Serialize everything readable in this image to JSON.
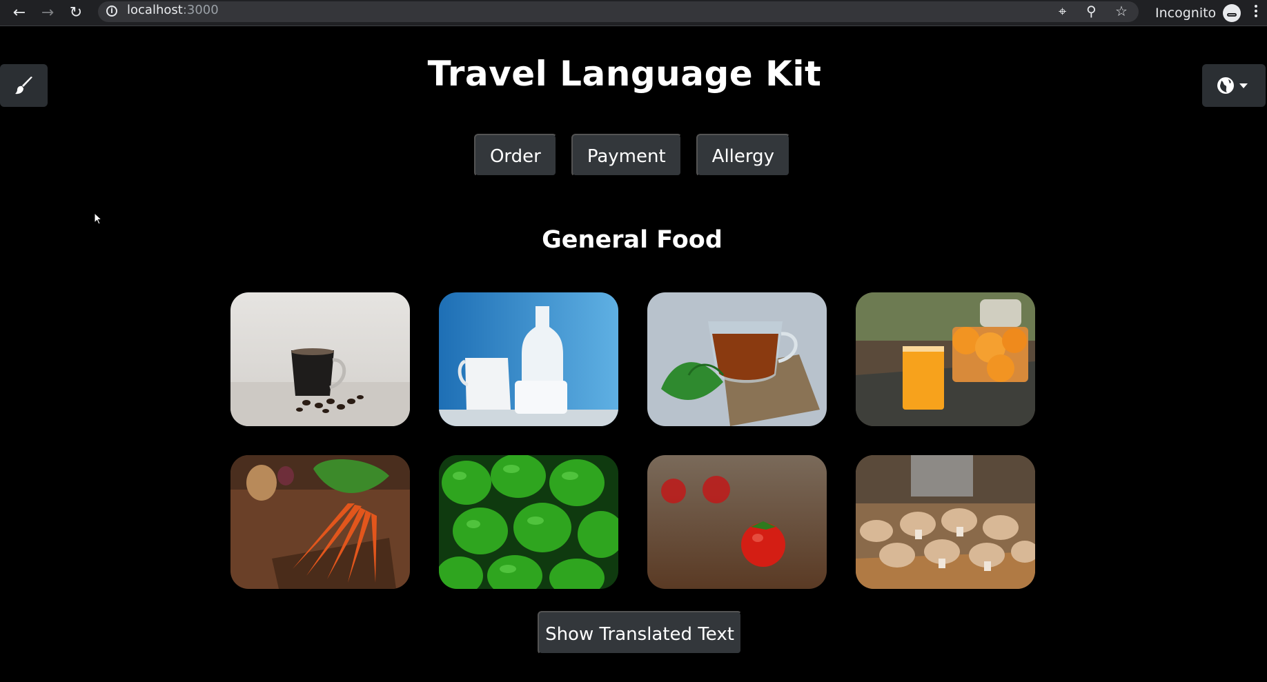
{
  "browser": {
    "url_host": "localhost",
    "url_port": ":3000",
    "mode_label": "Incognito"
  },
  "page": {
    "title": "Travel Language Kit",
    "tabs": [
      {
        "label": "Order"
      },
      {
        "label": "Payment"
      },
      {
        "label": "Allergy"
      }
    ],
    "section_title": "General Food",
    "cards": [
      {
        "name": "coffee"
      },
      {
        "name": "milk"
      },
      {
        "name": "tea"
      },
      {
        "name": "orange-juice"
      },
      {
        "name": "carrot"
      },
      {
        "name": "green-pepper"
      },
      {
        "name": "tomato"
      },
      {
        "name": "mushroom"
      }
    ],
    "show_translated_label": "Show Translated Text"
  },
  "colors": {
    "background": "#000000",
    "button": "#33373b",
    "text": "#ffffff"
  }
}
